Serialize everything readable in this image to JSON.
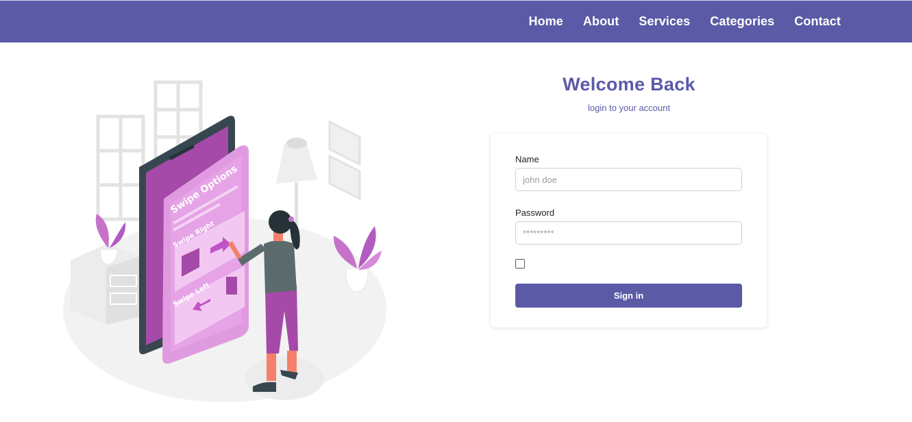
{
  "nav": {
    "items": [
      {
        "label": "Home"
      },
      {
        "label": "About"
      },
      {
        "label": "Services"
      },
      {
        "label": "Categories"
      },
      {
        "label": "Contact"
      }
    ]
  },
  "illustration": {
    "screen_title": "Swipe Options",
    "swipe_right": "Swipe Right",
    "swipe_left": "Swipe Left"
  },
  "login": {
    "title": "Welcome Back",
    "subtitle": "login to your account",
    "name_label": "Name",
    "name_placeholder": "john doe",
    "password_label": "Password",
    "password_placeholder": "*********",
    "remember_checked": false,
    "submit_label": "Sign in"
  },
  "colors": {
    "brand": "#5b5aa6",
    "accent": "#b05cc1"
  }
}
